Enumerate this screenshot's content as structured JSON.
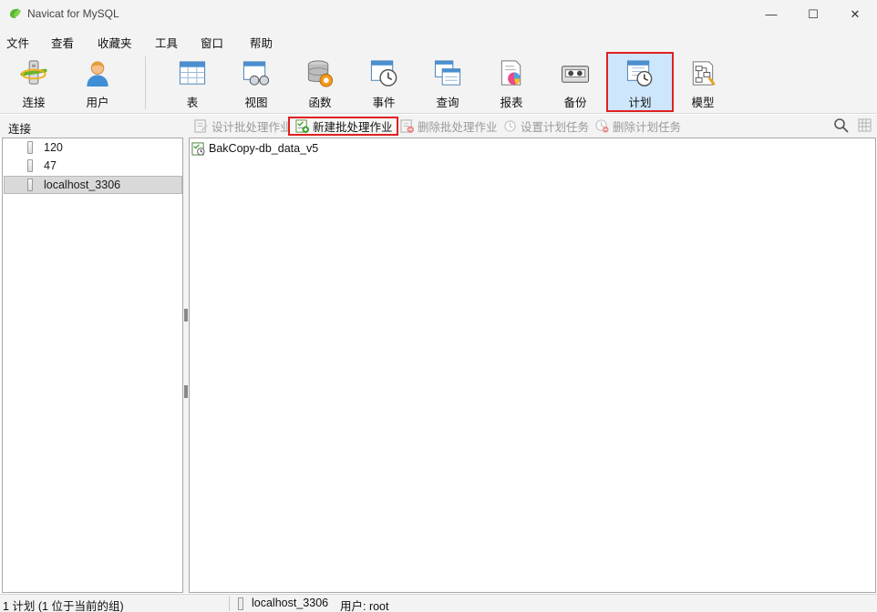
{
  "window": {
    "title": "Navicat for MySQL",
    "controls": {
      "minimize": "—",
      "maximize": "☐",
      "close": "✕"
    }
  },
  "menu": [
    "文件",
    "查看",
    "收藏夹",
    "工具",
    "窗口",
    "帮助"
  ],
  "toolbar": {
    "buttons": [
      {
        "label": "连接",
        "icon": "connection-icon"
      },
      {
        "label": "用户",
        "icon": "user-icon"
      },
      {
        "label": "表",
        "icon": "table-icon"
      },
      {
        "label": "视图",
        "icon": "view-icon"
      },
      {
        "label": "函数",
        "icon": "function-icon"
      },
      {
        "label": "事件",
        "icon": "event-icon"
      },
      {
        "label": "查询",
        "icon": "query-icon"
      },
      {
        "label": "报表",
        "icon": "report-icon"
      },
      {
        "label": "备份",
        "icon": "backup-icon"
      },
      {
        "label": "计划",
        "icon": "schedule-icon",
        "active": true
      },
      {
        "label": "模型",
        "icon": "model-icon"
      }
    ]
  },
  "subbar": {
    "connection_header": "连接",
    "actions": [
      {
        "label": "设计批处理作业",
        "enabled": false
      },
      {
        "label": "新建批处理作业",
        "enabled": true
      },
      {
        "label": "删除批处理作业",
        "enabled": false
      },
      {
        "label": "设置计划任务",
        "enabled": false
      },
      {
        "label": "删除计划任务",
        "enabled": false
      }
    ]
  },
  "connections": [
    {
      "name": "120",
      "selected": false
    },
    {
      "name": "47",
      "selected": false
    },
    {
      "name": "localhost_3306",
      "selected": true
    }
  ],
  "jobs": [
    {
      "name": "BakCopy-db_data_v5"
    }
  ],
  "status": {
    "count": "1 计划 (1 位于当前的组)",
    "connection": "localhost_3306",
    "user": "用户: root"
  },
  "colors": {
    "accent_border": "#e02020",
    "active_bg": "#cde6fb",
    "selected_row": "#d9d9d9"
  }
}
